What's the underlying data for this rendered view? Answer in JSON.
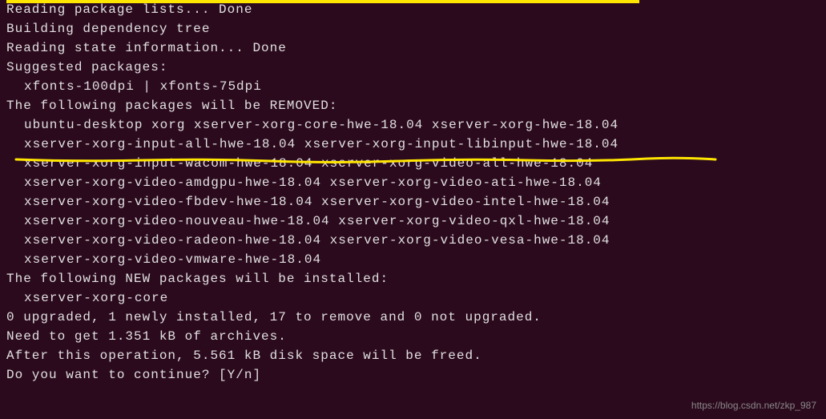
{
  "terminal": {
    "lines": [
      {
        "text": "Reading package lists... Done",
        "indent": false
      },
      {
        "text": "Building dependency tree",
        "indent": false
      },
      {
        "text": "Reading state information... Done",
        "indent": false
      },
      {
        "text": "Suggested packages:",
        "indent": false
      },
      {
        "text": "xfonts-100dpi | xfonts-75dpi",
        "indent": true
      },
      {
        "text": "The following packages will be REMOVED:",
        "indent": false
      },
      {
        "text": "ubuntu-desktop xorg xserver-xorg-core-hwe-18.04 xserver-xorg-hwe-18.04",
        "indent": true
      },
      {
        "text": "xserver-xorg-input-all-hwe-18.04 xserver-xorg-input-libinput-hwe-18.04",
        "indent": true
      },
      {
        "text": "xserver-xorg-input-wacom-hwe-18.04 xserver-xorg-video-all-hwe-18.04",
        "indent": true
      },
      {
        "text": "xserver-xorg-video-amdgpu-hwe-18.04 xserver-xorg-video-ati-hwe-18.04",
        "indent": true
      },
      {
        "text": "xserver-xorg-video-fbdev-hwe-18.04 xserver-xorg-video-intel-hwe-18.04",
        "indent": true
      },
      {
        "text": "xserver-xorg-video-nouveau-hwe-18.04 xserver-xorg-video-qxl-hwe-18.04",
        "indent": true
      },
      {
        "text": "xserver-xorg-video-radeon-hwe-18.04 xserver-xorg-video-vesa-hwe-18.04",
        "indent": true
      },
      {
        "text": "xserver-xorg-video-vmware-hwe-18.04",
        "indent": true
      },
      {
        "text": "The following NEW packages will be installed:",
        "indent": false
      },
      {
        "text": "xserver-xorg-core",
        "indent": true
      },
      {
        "text": "0 upgraded, 1 newly installed, 17 to remove and 0 not upgraded.",
        "indent": false
      },
      {
        "text": "Need to get 1.351 kB of archives.",
        "indent": false
      },
      {
        "text": "After this operation, 5.561 kB disk space will be freed.",
        "indent": false
      },
      {
        "text": "Do you want to continue? [Y/n]",
        "indent": false
      }
    ]
  },
  "watermark": "https://blog.csdn.net/zkp_987"
}
